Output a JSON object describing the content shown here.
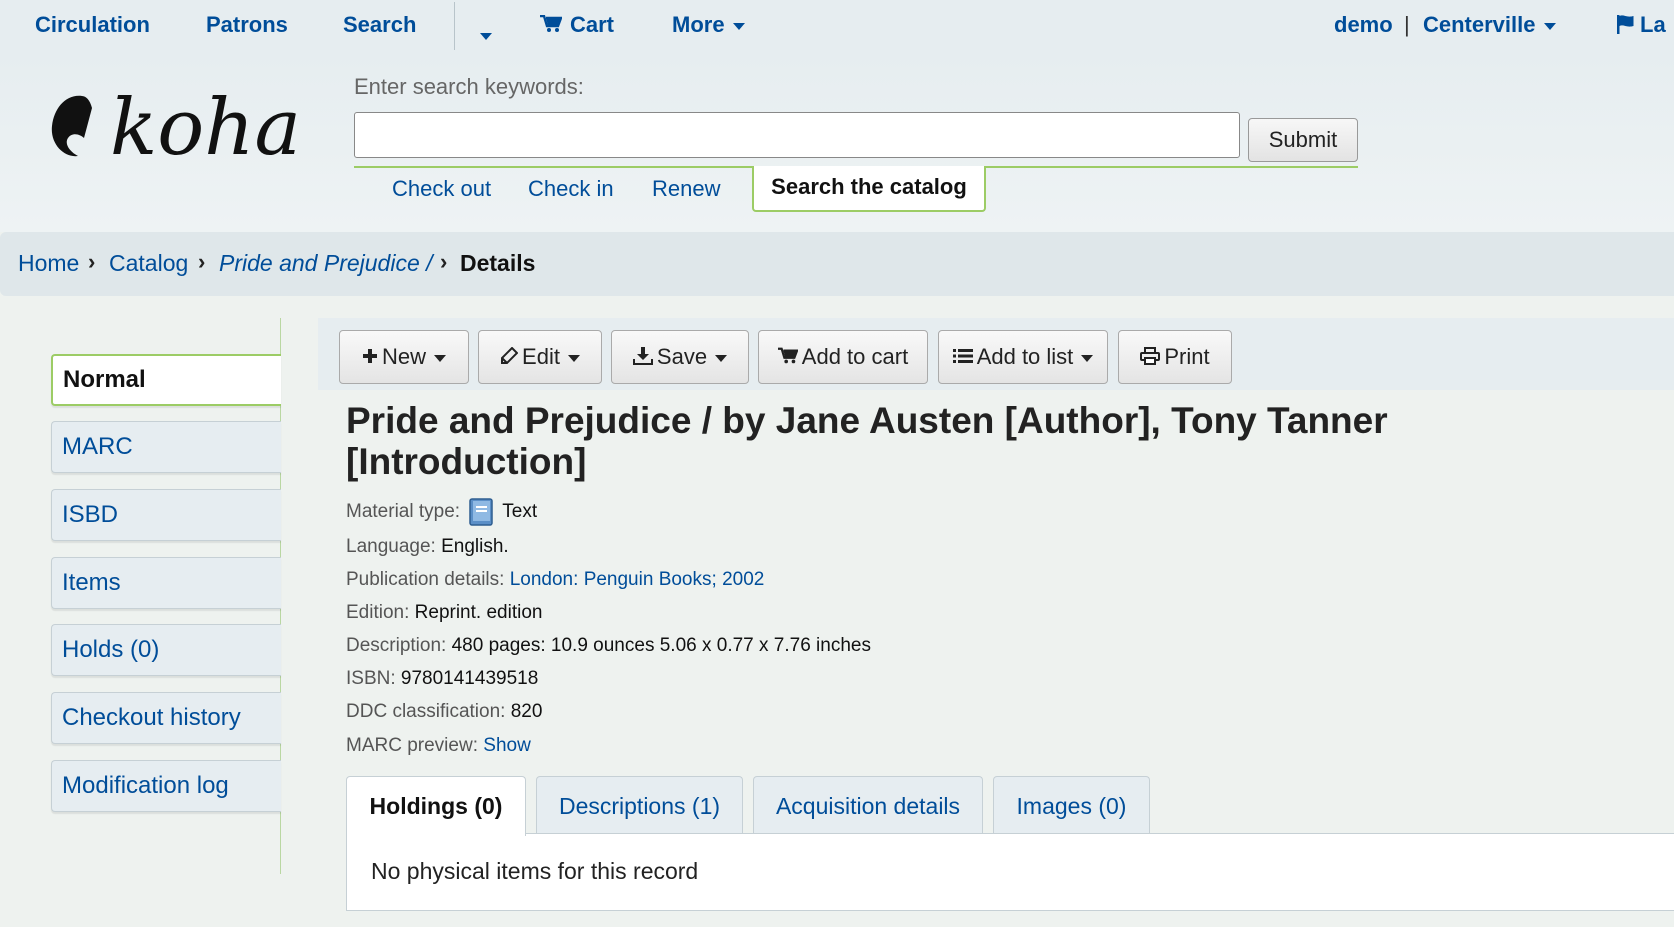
{
  "topnav": {
    "items": [
      "Circulation",
      "Patrons",
      "Search",
      "Cart",
      "More"
    ],
    "user": "demo",
    "separator": "|",
    "library": "Centerville",
    "language_partial": "La"
  },
  "header": {
    "logo_text": "koha",
    "search_label": "Enter search keywords:",
    "search_value": "",
    "submit_label": "Submit",
    "quick_tabs": [
      "Check out",
      "Check in",
      "Renew",
      "Search the catalog"
    ]
  },
  "breadcrumb": {
    "items": [
      "Home",
      "Catalog",
      "Pride and Prejudice /",
      "Details"
    ],
    "separator": "›"
  },
  "sidebar": {
    "items": [
      {
        "label": "Normal",
        "active": true
      },
      {
        "label": "MARC"
      },
      {
        "label": "ISBD"
      },
      {
        "label": "Items"
      },
      {
        "label": "Holds (0)"
      },
      {
        "label": "Checkout history"
      },
      {
        "label": "Modification log"
      }
    ]
  },
  "toolbar": {
    "new_label": "New",
    "edit_label": "Edit",
    "save_label": "Save",
    "add_to_cart_label": "Add to cart",
    "add_to_list_label": "Add to list",
    "print_label": "Print"
  },
  "record": {
    "title": "Pride and Prejudice / by Jane Austen [Author], Tony Tanner [Introduction]",
    "material_type_label": "Material type:",
    "material_type": "Text",
    "language_label": "Language:",
    "language": "English.",
    "publication_label": "Publication details:",
    "publication_place": "London:",
    "publisher": "Penguin Books;",
    "publication_year": "2002",
    "edition_label": "Edition:",
    "edition": "Reprint. edition",
    "description_label": "Description:",
    "description": "480 pages: 10.9 ounces 5.06 x 0.77 x 7.76 inches",
    "isbn_label": "ISBN:",
    "isbn": "9780141439518",
    "ddc_label": "DDC classification:",
    "ddc": "820",
    "marc_preview_label": "MARC preview:",
    "marc_preview_link": "Show"
  },
  "tabs": {
    "items": [
      "Holdings (0)",
      "Descriptions (1)",
      "Acquisition details",
      "Images (0)"
    ],
    "panel_text": "No physical items for this record"
  },
  "colors": {
    "link": "#004d99",
    "accent_green": "#9ccc65",
    "header_bg": "#e6edf0"
  }
}
